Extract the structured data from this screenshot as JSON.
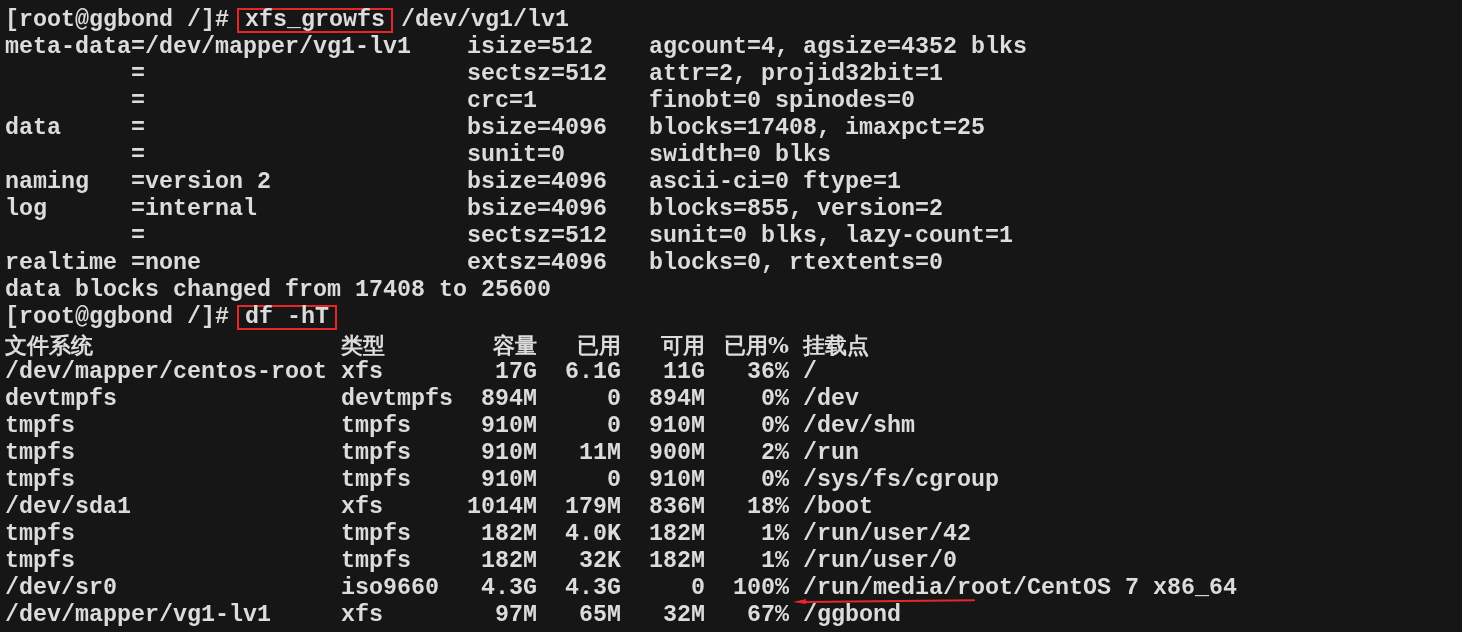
{
  "terminal": {
    "lines": [
      {
        "kind": "command",
        "prompt": "[root@ggbond /]#",
        "command": "xfs_growfs",
        "args": "/dev/vg1/lv1",
        "highlighted": true
      },
      {
        "kind": "output",
        "text": "meta-data=/dev/mapper/vg1-lv1    isize=512    agcount=4, agsize=4352 blks"
      },
      {
        "kind": "output",
        "text": "         =                       sectsz=512   attr=2, projid32bit=1"
      },
      {
        "kind": "output",
        "text": "         =                       crc=1        finobt=0 spinodes=0"
      },
      {
        "kind": "output",
        "text": "data     =                       bsize=4096   blocks=17408, imaxpct=25"
      },
      {
        "kind": "output",
        "text": "         =                       sunit=0      swidth=0 blks"
      },
      {
        "kind": "output",
        "text": "naming   =version 2              bsize=4096   ascii-ci=0 ftype=1"
      },
      {
        "kind": "output",
        "text": "log      =internal               bsize=4096   blocks=855, version=2"
      },
      {
        "kind": "output",
        "text": "         =                       sectsz=512   sunit=0 blks, lazy-count=1"
      },
      {
        "kind": "output",
        "text": "realtime =none                   extsz=4096   blocks=0, rtextents=0"
      },
      {
        "kind": "output",
        "text": "data blocks changed from 17408 to 25600"
      },
      {
        "kind": "command",
        "prompt": "[root@ggbond /]#",
        "command": "df -hT",
        "highlighted": true
      }
    ],
    "df_table": {
      "columns": [
        "文件系统",
        "类型",
        "容量",
        "已用",
        "可用",
        "已用%",
        "挂载点"
      ],
      "rows": [
        {
          "cells": [
            "/dev/mapper/centos-root",
            "xfs",
            "17G",
            "6.1G",
            "11G",
            "36%",
            "/"
          ]
        },
        {
          "cells": [
            "devtmpfs",
            "devtmpfs",
            "894M",
            "0",
            "894M",
            "0%",
            "/dev"
          ]
        },
        {
          "cells": [
            "tmpfs",
            "tmpfs",
            "910M",
            "0",
            "910M",
            "0%",
            "/dev/shm"
          ]
        },
        {
          "cells": [
            "tmpfs",
            "tmpfs",
            "910M",
            "11M",
            "900M",
            "2%",
            "/run"
          ]
        },
        {
          "cells": [
            "tmpfs",
            "tmpfs",
            "910M",
            "0",
            "910M",
            "0%",
            "/sys/fs/cgroup"
          ]
        },
        {
          "cells": [
            "/dev/sda1",
            "xfs",
            "1014M",
            "179M",
            "836M",
            "18%",
            "/boot"
          ]
        },
        {
          "cells": [
            "tmpfs",
            "tmpfs",
            "182M",
            "4.0K",
            "182M",
            "1%",
            "/run/user/42"
          ]
        },
        {
          "cells": [
            "tmpfs",
            "tmpfs",
            "182M",
            "32K",
            "182M",
            "1%",
            "/run/user/0"
          ]
        },
        {
          "cells": [
            "/dev/sr0",
            "iso9660",
            "4.3G",
            "4.3G",
            "0",
            "100%",
            "/run/media/root/CentOS 7 x86_64"
          ]
        },
        {
          "cells": [
            "/dev/mapper/vg1-lv1",
            "xfs",
            "97M",
            "65M",
            "32M",
            "67%",
            "/ggbond"
          ]
        }
      ]
    }
  },
  "annotation": {
    "kind": "arrow"
  }
}
